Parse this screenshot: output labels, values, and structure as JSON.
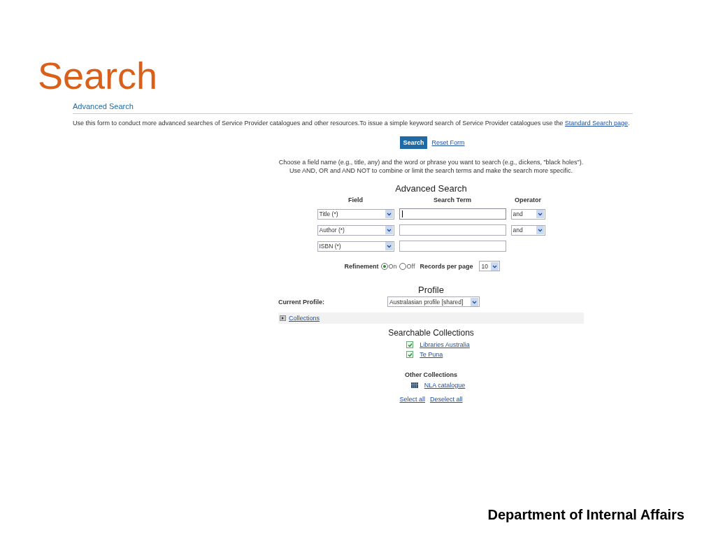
{
  "slide": {
    "title": "Search",
    "footer": "Department of Internal Affairs"
  },
  "page": {
    "heading": "Advanced Search",
    "intro": "Use this form to conduct more advanced searches of Service Provider catalogues and other resources.To issue a simple keyword search of Service Provider catalogues use the ",
    "intro_link": "Standard Search page",
    "intro_end": "."
  },
  "actions": {
    "search": "Search",
    "reset": "Reset Form"
  },
  "instructions": [
    "Choose a field name (e.g., title, any) and the word or phrase you want to search (e.g., dickens, \"black holes\").",
    "Use AND, OR and AND NOT to combine or limit the search terms and make the search more specific."
  ],
  "form": {
    "heading": "Advanced Search",
    "columns": [
      "Field",
      "Search Term",
      "Operator"
    ],
    "rows": [
      {
        "field": "Title (*)",
        "operator": "and",
        "focused": true
      },
      {
        "field": "Author (*)",
        "operator": "and",
        "focused": false
      },
      {
        "field": "ISBN (*)",
        "focused": false
      }
    ],
    "refinement": {
      "label": "Refinement",
      "options": [
        {
          "label": "On",
          "selected": true
        },
        {
          "label": "Off",
          "selected": false
        }
      ]
    },
    "records": {
      "label": "Records per page",
      "value": "10"
    }
  },
  "profile": {
    "heading": "Profile",
    "label": "Current Profile:",
    "value": "Australasian profile [shared]"
  },
  "collections": {
    "toggle": "Collections",
    "heading": "Searchable Collections",
    "items": [
      {
        "label": "Libraries Australia",
        "checked": true
      },
      {
        "label": "Te Puna",
        "checked": true
      }
    ],
    "other_heading": "Other Collections",
    "other_items": [
      {
        "label": "NLA catalogue"
      }
    ],
    "select_all": "Select all",
    "deselect_all": "Deselect all"
  }
}
